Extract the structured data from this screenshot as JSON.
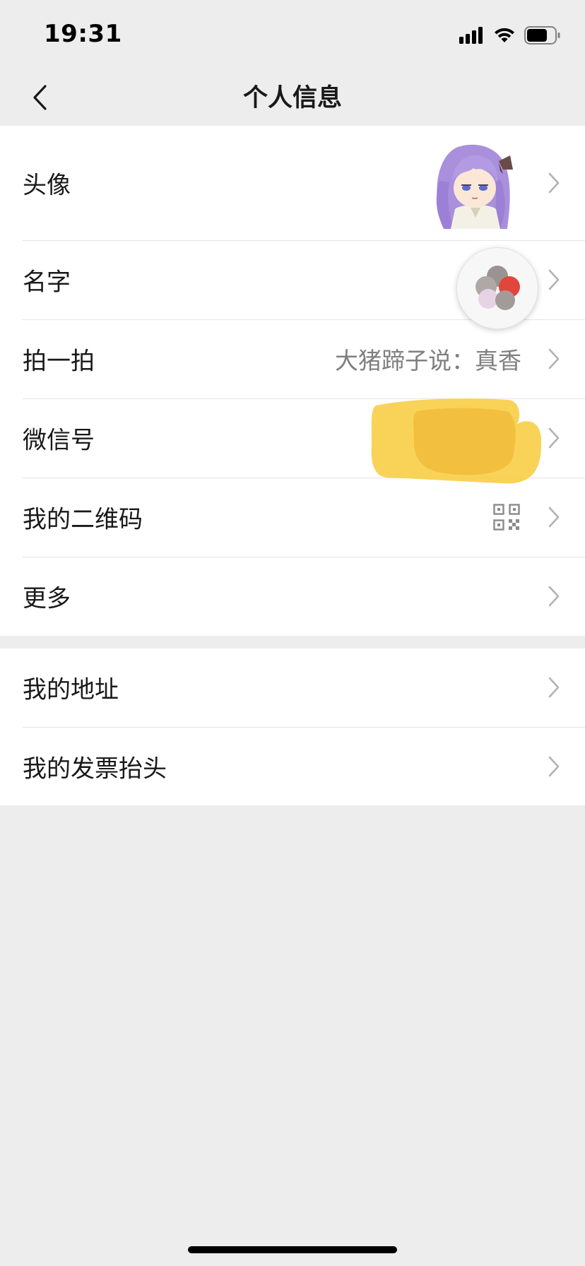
{
  "status_bar": {
    "time": "19:31",
    "icons": [
      "cellular-signal-icon",
      "wifi-icon",
      "battery-icon"
    ]
  },
  "nav": {
    "title": "个人信息",
    "back_icon": "chevron-left-icon"
  },
  "profile_rows": [
    {
      "label": "头像",
      "value": "",
      "accessory": "avatar-image"
    },
    {
      "label": "名字",
      "value": "",
      "accessory": "none"
    },
    {
      "label": "拍一拍",
      "value": "大猪蹄子说：真香",
      "accessory": "none"
    },
    {
      "label": "微信号",
      "value": "",
      "accessory": "redacted"
    },
    {
      "label": "我的二维码",
      "value": "",
      "accessory": "qr-code-icon"
    },
    {
      "label": "更多",
      "value": "",
      "accessory": "none"
    }
  ],
  "extra_rows": [
    {
      "label": "我的地址"
    },
    {
      "label": "我的发票抬头"
    }
  ],
  "colors": {
    "page_background": "#ededed",
    "cell_background": "#ffffff",
    "text_primary": "#191919",
    "text_secondary": "#7f7f7f",
    "chevron": "#b2b2b2",
    "redaction": "#f5c242"
  }
}
